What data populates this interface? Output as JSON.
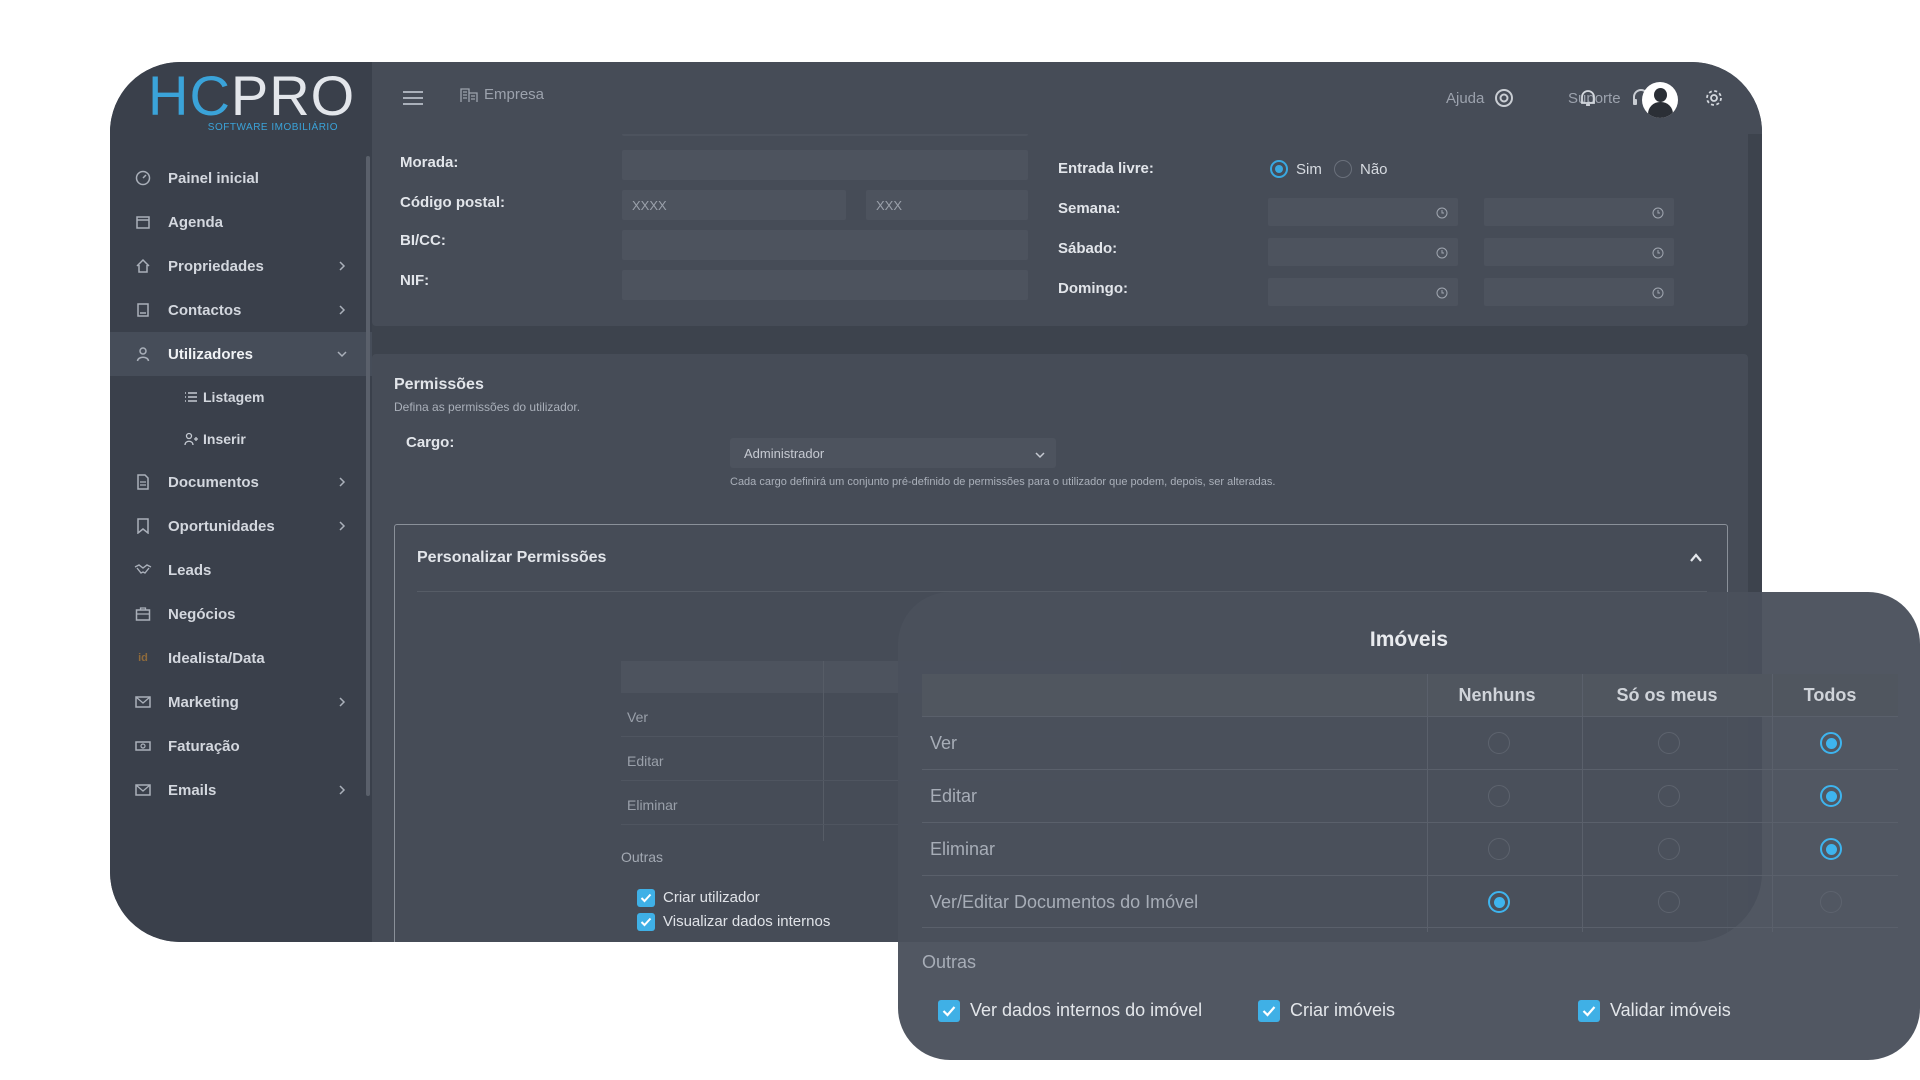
{
  "brand": {
    "logo_hc": "HC",
    "logo_pro": "PRO",
    "tagline": "SOFTWARE IMOBILIÁRIO"
  },
  "topbar": {
    "breadcrumb": "Empresa",
    "help": "Ajuda",
    "support": "Suporte"
  },
  "sidebar": {
    "items": [
      {
        "label": "Painel inicial"
      },
      {
        "label": "Agenda"
      },
      {
        "label": "Propriedades"
      },
      {
        "label": "Contactos"
      },
      {
        "label": "Utilizadores"
      },
      {
        "label": "Listagem"
      },
      {
        "label": "Inserir"
      },
      {
        "label": "Documentos"
      },
      {
        "label": "Oportunidades"
      },
      {
        "label": "Leads"
      },
      {
        "label": "Negócios"
      },
      {
        "label": "Idealista/Data",
        "icon_text": "id"
      },
      {
        "label": "Marketing"
      },
      {
        "label": "Faturação"
      },
      {
        "label": "Emails"
      }
    ]
  },
  "form": {
    "morada": "Morada:",
    "codigo_postal": "Código postal:",
    "cp_ph1": "XXXX",
    "cp_ph2": "XXX",
    "bicc": "BI/CC:",
    "nif": "NIF:",
    "entrada_livre": "Entrada livre:",
    "sim": "Sim",
    "nao": "Não",
    "semana": "Semana:",
    "sabado": "Sábado:",
    "domingo": "Domingo:"
  },
  "permissions": {
    "title": "Permissões",
    "subtitle": "Defina as permissões do utilizador.",
    "cargo_label": "Cargo:",
    "cargo_value": "Administrador",
    "cargo_hint": "Cada cargo definirá um conjunto pré-definido de permissões para o utilizador que podem, depois, ser alteradas.",
    "custom_title": "Personalizar Permissões",
    "bg_rows": [
      "Ver",
      "Editar",
      "Eliminar"
    ],
    "outras": "Outras",
    "checks": [
      "Criar utilizador",
      "Visualizar dados internos"
    ]
  },
  "zoom": {
    "title": "Imóveis",
    "columns": [
      "Nenhuns",
      "Só os meus",
      "Todos"
    ],
    "rows": [
      {
        "label": "Ver",
        "selected": 2
      },
      {
        "label": "Editar",
        "selected": 2
      },
      {
        "label": "Eliminar",
        "selected": 2
      },
      {
        "label": "Ver/Editar Documentos do Imóvel",
        "selected": 0
      }
    ],
    "outras": "Outras",
    "checks": [
      "Ver dados internos do imóvel",
      "Criar imóveis",
      "Validar imóveis"
    ]
  },
  "colors": {
    "accent": "#39a8e0",
    "sidebar": "#3a404b",
    "surface": "#464c57"
  }
}
